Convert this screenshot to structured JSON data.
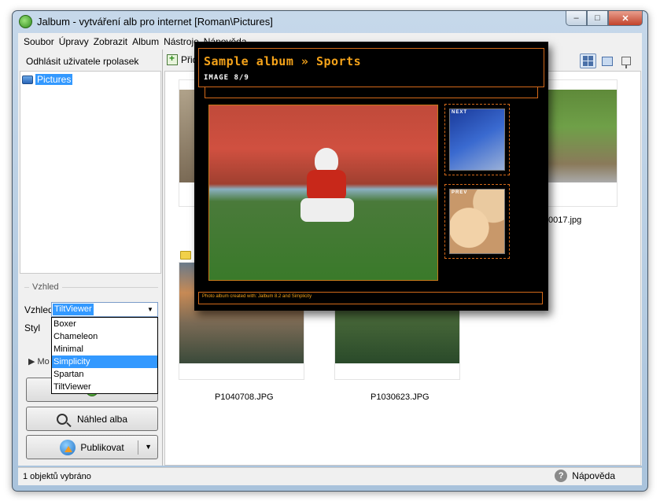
{
  "window": {
    "title": "Jalbum - vytváření alb pro internet [Roman\\Pictures]",
    "controls": {
      "minimize": "–",
      "maximize": "□",
      "close": "✕"
    }
  },
  "menu": [
    "Soubor",
    "Úpravy",
    "Zobrazit",
    "Album",
    "Nástroje",
    "Nápověda"
  ],
  "left": {
    "logout": "Odhlásit uživatele rpolasek",
    "tree_root": "Pictures",
    "section_title": "Vzhled",
    "vzhled_label": "Vzhled",
    "vzhled_value": "TiltViewer",
    "styl_label": "Styl",
    "more_label": "▶ Mo",
    "dropdown_options": [
      "Boxer",
      "Chameleon",
      "Minimal",
      "Simplicity",
      "Spartan",
      "TiltViewer"
    ],
    "dropdown_selected": "Simplicity",
    "preview_button": "Náhled alba",
    "publish_button": "Publikovat"
  },
  "toolbar": {
    "add_label": "Přid"
  },
  "gallery": {
    "items": [
      {
        "caption": "0017.jpg"
      },
      {
        "caption": "P1040708.JPG"
      },
      {
        "caption": "P1030623.JPG"
      }
    ]
  },
  "preview": {
    "title": "Sample album » Sports",
    "subtitle": "IMAGE 8/9",
    "next_label": "NEXT",
    "prev_label": "PREV",
    "credit": "Photo album created with: Jalbum 8.2 and Simplicity"
  },
  "status": {
    "text": "1 objektů vybráno",
    "help": "Nápověda"
  },
  "colors": {
    "selection": "#3399ff",
    "accent_orange": "#f5a31a",
    "frame_orange": "#d46a1a"
  },
  "icons": [
    "jalbum-logo-icon",
    "folder-pictures-icon",
    "magnifier-icon",
    "globe-upload-icon",
    "add-icon",
    "thumbnail-view-icon",
    "list-view-icon",
    "slideshow-view-icon",
    "help-icon",
    "folder-icon"
  ]
}
